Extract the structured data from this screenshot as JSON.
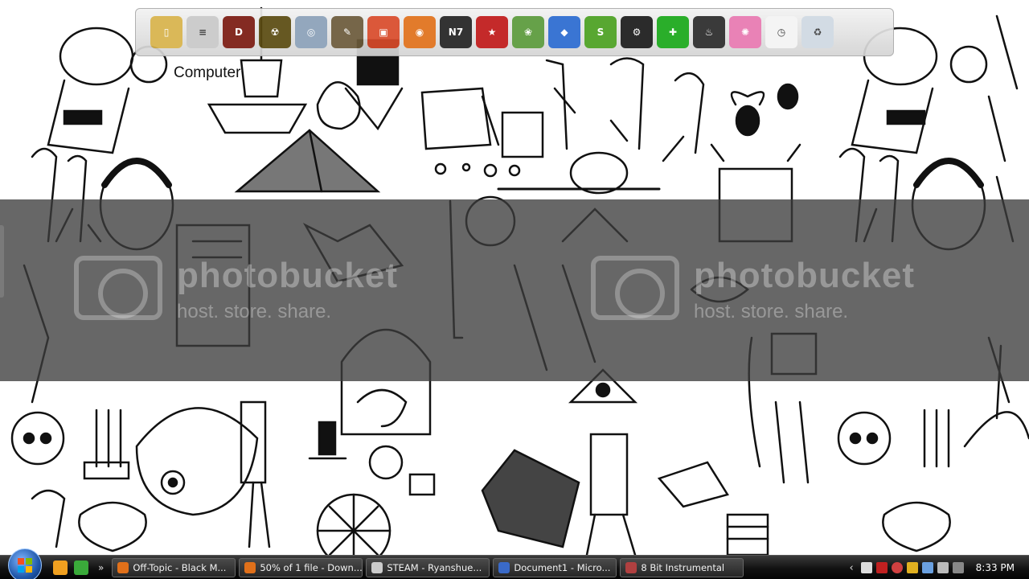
{
  "desktop": {
    "icon_label": "Computer",
    "watermark": {
      "title": "photobucket",
      "subtitle": "host. store. share."
    }
  },
  "dock": {
    "items": [
      {
        "name": "folder-icon",
        "color": "#d7b24a",
        "glyph": "▯"
      },
      {
        "name": "document-icon",
        "color": "#c8c8c8",
        "glyph": "≡"
      },
      {
        "name": "diablo-icon",
        "color": "#7a1a10",
        "glyph": "D"
      },
      {
        "name": "radiation-icon",
        "color": "#5a4a10",
        "glyph": "☢"
      },
      {
        "name": "disc-icon",
        "color": "#8aa0b8",
        "glyph": "◎"
      },
      {
        "name": "gimp-icon",
        "color": "#6b5a3a",
        "glyph": "✎"
      },
      {
        "name": "bag-icon",
        "color": "#d84a2a",
        "glyph": "▣"
      },
      {
        "name": "firefox-icon",
        "color": "#e0701a",
        "glyph": "◉"
      },
      {
        "name": "n7-icon",
        "color": "#222222",
        "glyph": "N7"
      },
      {
        "name": "movie-icon",
        "color": "#c01818",
        "glyph": "★"
      },
      {
        "name": "plant-icon",
        "color": "#5a9a3a",
        "glyph": "❀"
      },
      {
        "name": "sims-icon",
        "color": "#2a6ad0",
        "glyph": "◆"
      },
      {
        "name": "s-icon",
        "color": "#4aa020",
        "glyph": "S"
      },
      {
        "name": "steam-icon",
        "color": "#1a1a1a",
        "glyph": "⚙"
      },
      {
        "name": "plus-icon",
        "color": "#18a818",
        "glyph": "✚"
      },
      {
        "name": "flame-icon",
        "color": "#2a2a2a",
        "glyph": "♨"
      },
      {
        "name": "network-icon",
        "color": "#e878b0",
        "glyph": "✺"
      },
      {
        "name": "clock-icon",
        "color": "#f4f4f4",
        "glyph": "◷"
      },
      {
        "name": "recycle-bin-icon",
        "color": "#cfd8e2",
        "glyph": "♻"
      }
    ]
  },
  "taskbar": {
    "tasks": [
      {
        "label": "Off-Topic - Black M...",
        "icon_color": "#e0701a"
      },
      {
        "label": "50% of 1 file - Down...",
        "icon_color": "#e0701a"
      },
      {
        "label": "STEAM - Ryanshue...",
        "icon_color": "#cccccc"
      },
      {
        "label": "Document1 - Micro...",
        "icon_color": "#3a6ac8"
      },
      {
        "label": "8 Bit Instrumental",
        "icon_color": "#b04040"
      }
    ],
    "clock": "8:33 PM"
  }
}
